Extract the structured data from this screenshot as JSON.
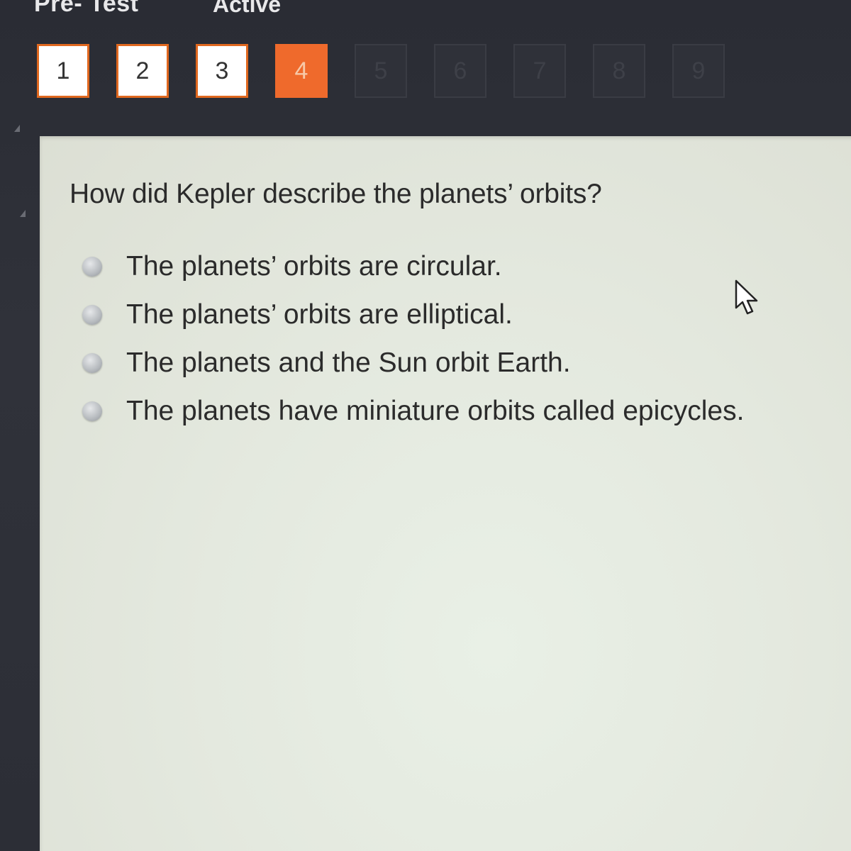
{
  "header": {
    "title": "Pre- Test",
    "status": "Active"
  },
  "question_nav": [
    {
      "label": "1",
      "state": "answered"
    },
    {
      "label": "2",
      "state": "answered"
    },
    {
      "label": "3",
      "state": "answered"
    },
    {
      "label": "4",
      "state": "current"
    },
    {
      "label": "5",
      "state": "locked"
    },
    {
      "label": "6",
      "state": "locked"
    },
    {
      "label": "7",
      "state": "locked"
    },
    {
      "label": "8",
      "state": "locked"
    },
    {
      "label": "9",
      "state": "locked"
    }
  ],
  "question": {
    "text": "How did Kepler describe the planets’ orbits?",
    "options": [
      "The planets’ orbits are circular.",
      "The planets’ orbits are elliptical.",
      "The planets and the Sun orbit Earth.",
      "The planets have miniature orbits called epicycles."
    ]
  },
  "colors": {
    "accent": "#ef6a2c",
    "panel": "#e6ece2",
    "background": "#2c2e36"
  },
  "icons": {
    "cursor": "pointer-cursor-icon",
    "radio": "radio-button-icon"
  }
}
